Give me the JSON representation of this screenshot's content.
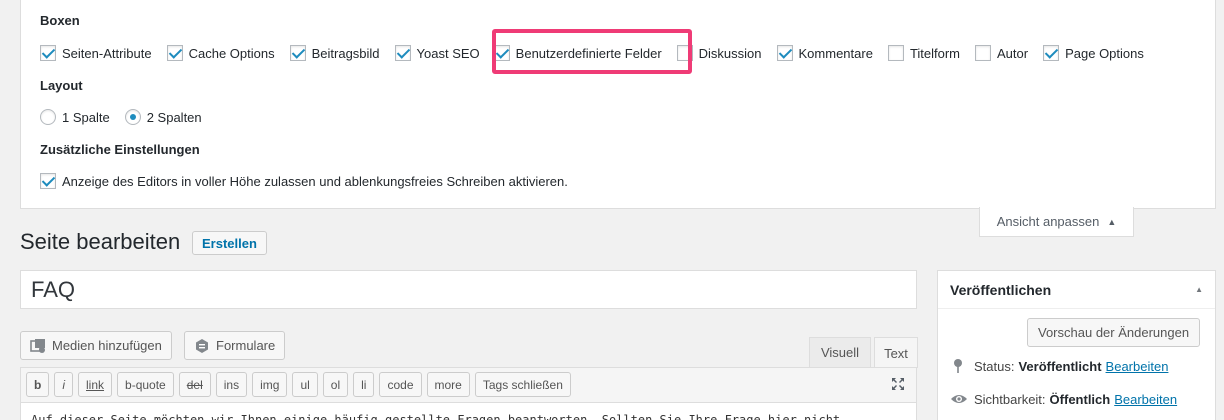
{
  "screen_options": {
    "boxes_title": "Boxen",
    "boxes": [
      {
        "label": "Seiten-Attribute",
        "checked": true
      },
      {
        "label": "Cache Options",
        "checked": true
      },
      {
        "label": "Beitragsbild",
        "checked": true
      },
      {
        "label": "Yoast SEO",
        "checked": true
      },
      {
        "label": "Benutzerdefinierte Felder",
        "checked": true
      },
      {
        "label": "Diskussion",
        "checked": false
      },
      {
        "label": "Kommentare",
        "checked": true
      },
      {
        "label": "Titelform",
        "checked": false
      },
      {
        "label": "Autor",
        "checked": false
      },
      {
        "label": "Page Options",
        "checked": true
      }
    ],
    "layout_title": "Layout",
    "layout_options": [
      {
        "label": "1 Spalte",
        "checked": false
      },
      {
        "label": "2 Spalten",
        "checked": true
      }
    ],
    "extra_title": "Zusätzliche Einstellungen",
    "extra_label": "Anzeige des Editors in voller Höhe zulassen und ablenkungsfreies Schreiben aktivieren.",
    "tab_label": "Ansicht anpassen"
  },
  "page": {
    "title": "Seite bearbeiten",
    "new_button": "Erstellen",
    "post_title": "FAQ"
  },
  "editor": {
    "media_button": "Medien hinzufügen",
    "forms_button": "Formulare",
    "tab_visual": "Visuell",
    "tab_text": "Text",
    "quicktags": [
      "b",
      "i",
      "link",
      "b-quote",
      "del",
      "ins",
      "img",
      "ul",
      "ol",
      "li",
      "code",
      "more",
      "Tags schließen"
    ],
    "content": "Auf dieser Seite möchten wir Ihnen einige häufig gestellte Fragen beantworten. Sollten Sie Ihre Frage hier nicht"
  },
  "publish": {
    "title": "Veröffentlichen",
    "preview_button": "Vorschau der Änderungen",
    "status_label": "Status:",
    "status_value": "Veröffentlicht",
    "status_edit": "Bearbeiten",
    "visibility_label": "Sichtbarkeit:",
    "visibility_value": "Öffentlich",
    "visibility_edit": "Bearbeiten"
  },
  "colors": {
    "accent": "#0073aa",
    "checkmark": "#1e8cbe",
    "highlight": "#ef3b76"
  }
}
